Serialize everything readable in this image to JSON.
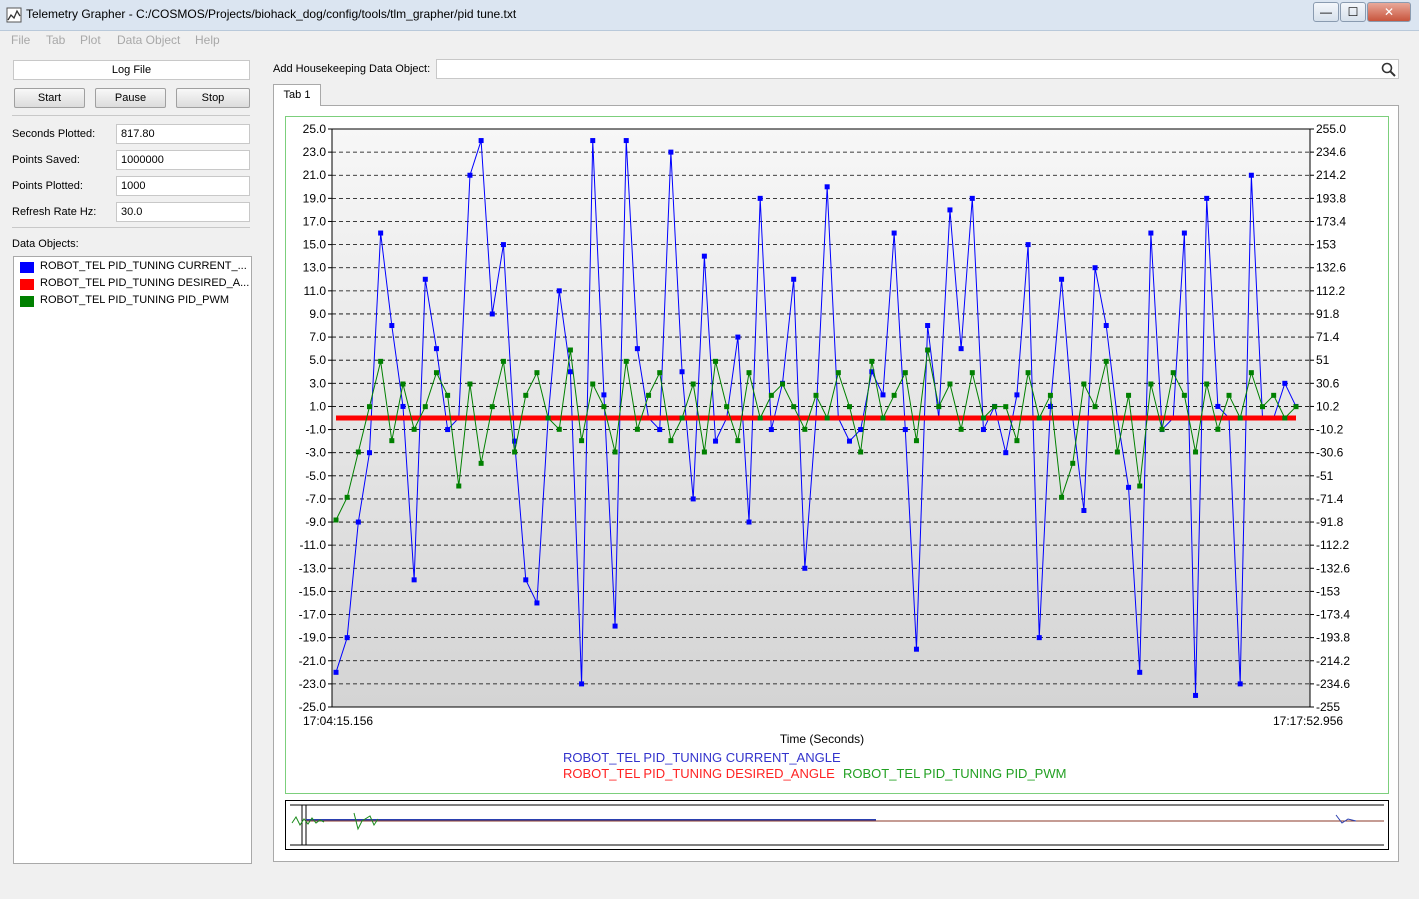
{
  "window": {
    "title": "Telemetry Grapher - C:/COSMOS/Projects/biohack_dog/config/tools/tlm_grapher/pid tune.txt",
    "minimize_label": "—",
    "maximize_label": "☐",
    "close_label": "✕"
  },
  "menu": [
    "File",
    "Tab",
    "Plot",
    "Data Object",
    "Help"
  ],
  "left_panel": {
    "log_file_label": "Log File",
    "buttons": [
      "Start",
      "Pause",
      "Stop"
    ],
    "fields": [
      {
        "label": "Seconds Plotted:",
        "value": "817.80"
      },
      {
        "label": "Points Saved:",
        "value": "1000000"
      },
      {
        "label": "Points Plotted:",
        "value": "1000"
      },
      {
        "label": "Refresh Rate Hz:",
        "value": "30.0"
      }
    ],
    "data_objects_label": "Data Objects:",
    "data_objects": [
      {
        "label": "ROBOT_TEL PID_TUNING CURRENT_...",
        "color": "#0000ff"
      },
      {
        "label": "ROBOT_TEL PID_TUNING DESIRED_A...",
        "color": "#ff0000"
      },
      {
        "label": "ROBOT_TEL PID_TUNING PID_PWM",
        "color": "#008000"
      }
    ]
  },
  "housekeeping": {
    "label": "Add Housekeeping Data Object:",
    "value": "",
    "search_icon": "search-icon"
  },
  "tabs": [
    "Tab 1"
  ],
  "chart_data": {
    "type": "line",
    "xlabel": "Time (Seconds)",
    "x_start_label": "17:04:15.156",
    "x_end_label": "17:17:52.956",
    "ylim_left": [
      -25,
      25
    ],
    "ylim_right": [
      -255,
      255
    ],
    "left_ticks": [
      "25.0",
      "23.0",
      "21.0",
      "19.0",
      "17.0",
      "15.0",
      "13.0",
      "11.0",
      "9.0",
      "7.0",
      "5.0",
      "3.0",
      "1.0",
      "-1.0",
      "-3.0",
      "-5.0",
      "-7.0",
      "-9.0",
      "-11.0",
      "-13.0",
      "-15.0",
      "-17.0",
      "-19.0",
      "-21.0",
      "-23.0",
      "-25.0"
    ],
    "right_ticks": [
      "255.0",
      "234.6",
      "214.2",
      "193.8",
      "173.4",
      "153",
      "132.6",
      "112.2",
      "91.8",
      "71.4",
      "51",
      "30.6",
      "10.2",
      "-10.2",
      "-30.6",
      "-51",
      "-71.4",
      "-91.8",
      "-112.2",
      "-132.6",
      "-153",
      "-173.4",
      "-193.8",
      "-214.2",
      "-234.6",
      "-255"
    ],
    "grid": true,
    "series": [
      {
        "name": "ROBOT_TEL PID_TUNING CURRENT_ANGLE",
        "color": "#0000ff",
        "values": [
          -22,
          -19,
          -9,
          -3,
          16,
          8,
          1,
          -14,
          12,
          6,
          -1,
          0,
          21,
          24,
          9,
          15,
          -2,
          -14,
          -16,
          0,
          11,
          4,
          -23,
          24,
          2,
          -18,
          24,
          6,
          0,
          -1,
          23,
          4,
          -7,
          14,
          -2,
          0,
          7,
          -9,
          19,
          -1,
          3,
          12,
          -13,
          0,
          20,
          0,
          -2,
          -1,
          4,
          2,
          16,
          -1,
          -20,
          8,
          0,
          18,
          6,
          19,
          -1,
          1,
          -3,
          2,
          15,
          -19,
          1,
          12,
          0,
          -8,
          13,
          8,
          0,
          -6,
          -22,
          16,
          -1,
          0,
          16,
          -24,
          19,
          1,
          0,
          -23,
          21,
          0,
          0,
          3,
          1
        ]
      },
      {
        "name": "ROBOT_TEL PID_TUNING DESIRED_ANGLE",
        "color": "#ff0000",
        "values": [
          0,
          0,
          0,
          0,
          0,
          0,
          0,
          0,
          0,
          0,
          0,
          0,
          0,
          0,
          0,
          0,
          0,
          0,
          0,
          0,
          0,
          0,
          0,
          0,
          0,
          0,
          0,
          0,
          0,
          0,
          0,
          0,
          0,
          0,
          0,
          0,
          0,
          0,
          0,
          0,
          0,
          0,
          0,
          0,
          0,
          0,
          0,
          0,
          0,
          0,
          0,
          0,
          0,
          0,
          0,
          0,
          0,
          0,
          0,
          0,
          0,
          0,
          0,
          0,
          0,
          0,
          0,
          0,
          0,
          0,
          0,
          0,
          0,
          0,
          0,
          0,
          0,
          0,
          0,
          0,
          0,
          0,
          0,
          0,
          0,
          0,
          0
        ]
      },
      {
        "name": "ROBOT_TEL PID_TUNING PID_PWM",
        "color": "#008000",
        "values": [
          -90,
          -70,
          -30,
          10,
          50,
          -20,
          30,
          -10,
          10,
          40,
          20,
          -60,
          30,
          -40,
          10,
          50,
          -30,
          20,
          40,
          0,
          -10,
          60,
          -20,
          30,
          10,
          -30,
          50,
          -10,
          20,
          40,
          -20,
          0,
          30,
          -30,
          50,
          10,
          -20,
          40,
          0,
          20,
          30,
          10,
          -10,
          20,
          0,
          40,
          10,
          -30,
          50,
          0,
          20,
          40,
          -20,
          60,
          10,
          30,
          -10,
          40,
          0,
          10,
          10,
          -20,
          40,
          0,
          20,
          -70,
          -40,
          30,
          10,
          50,
          -30,
          20,
          -60,
          30,
          -10,
          40,
          20,
          -30,
          30,
          -10,
          20,
          0,
          40,
          10,
          20,
          0,
          10
        ]
      }
    ],
    "legend": [
      {
        "name": "ROBOT_TEL PID_TUNING CURRENT_ANGLE",
        "color": "#3333cc"
      },
      {
        "name": "ROBOT_TEL PID_TUNING DESIRED_ANGLE",
        "color": "#ff2222"
      },
      {
        "name": "ROBOT_TEL PID_TUNING PID_PWM",
        "color": "#22a022"
      }
    ]
  }
}
